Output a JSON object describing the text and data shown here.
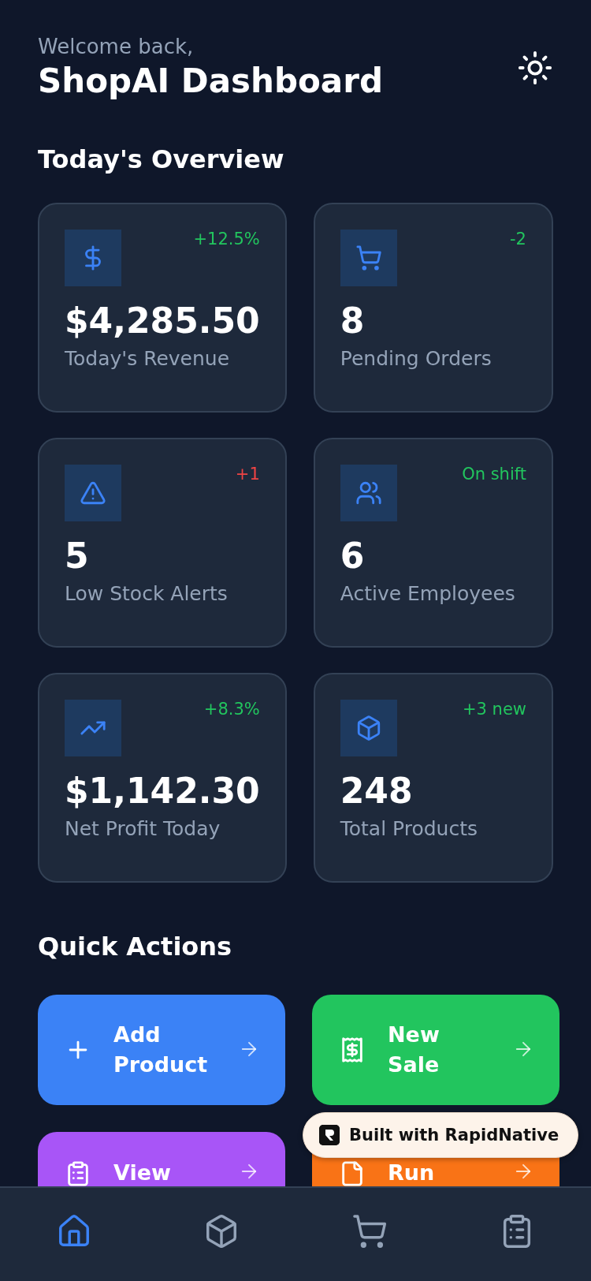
{
  "header": {
    "greeting": "Welcome back,",
    "title": "ShopAI Dashboard"
  },
  "overview": {
    "heading": "Today's Overview",
    "stats": [
      {
        "value": "$4,285.50",
        "label": "Today's Revenue",
        "change": "+12.5%",
        "color": "#22c55e"
      },
      {
        "value": "8",
        "label": "Pending Orders",
        "change": "-2",
        "color": "#22c55e"
      },
      {
        "value": "5",
        "label": "Low Stock Alerts",
        "change": "+1",
        "color": "#ef4444"
      },
      {
        "value": "6",
        "label": "Active Employees",
        "change": "On shift",
        "color": "#22c55e"
      },
      {
        "value": "$1,142.30",
        "label": "Net Profit Today",
        "change": "+8.3%",
        "color": "#22c55e"
      },
      {
        "value": "248",
        "label": "Total Products",
        "change": "+3 new",
        "color": "#22c55e"
      }
    ]
  },
  "quick_actions": {
    "heading": "Quick Actions",
    "actions": [
      {
        "label": "Add Product",
        "color": "#3b82f6"
      },
      {
        "label": "New Sale",
        "color": "#22c55e"
      },
      {
        "label": "View",
        "color": "#a855f7"
      },
      {
        "label": "Run",
        "color": "#f97316"
      }
    ]
  },
  "badge": {
    "text": "Built with RapidNative"
  },
  "bottom_nav": [
    {
      "selected": true
    },
    {
      "selected": false
    },
    {
      "selected": false
    },
    {
      "selected": false
    }
  ]
}
